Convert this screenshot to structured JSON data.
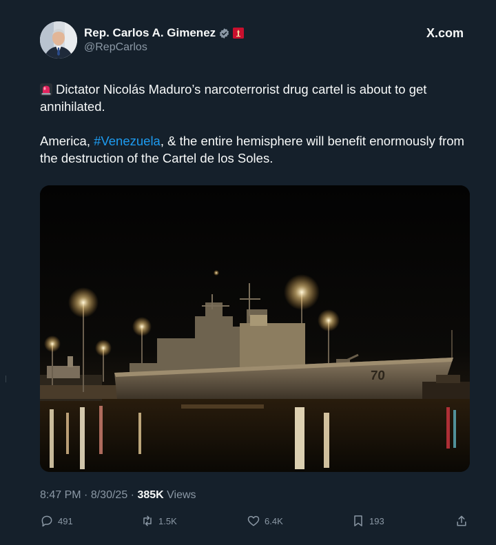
{
  "author": {
    "display_name": "Rep. Carlos A. Gimenez",
    "handle": "@RepCarlos",
    "verified_icon": "verified-badge-icon",
    "affiliation_icon": "government-flag-icon"
  },
  "source": {
    "label": "X.com",
    "icon": "x-logo-icon"
  },
  "tweet": {
    "paragraph1_emoji": "siren-icon",
    "paragraph1": "Dictator Nicolás Maduro’s narcoterrorist drug cartel is about to get annihilated.",
    "paragraph2_before": "America, ",
    "hashtag": "#Venezuela",
    "paragraph2_after": ", & the entire hemisphere will benefit enormously from the destruction of the Cartel de los Soles.",
    "media_description_icon": "warship-at-night-photo",
    "hull_number": "70"
  },
  "meta": {
    "time": "8:47 PM",
    "separator": "·",
    "date": "8/30/25",
    "views_count": "385K",
    "views_label": "Views"
  },
  "actions": {
    "replies": "491",
    "reposts": "1.5K",
    "likes": "6.4K",
    "bookmarks": "193"
  },
  "colors": {
    "background": "#15202b",
    "text_primary": "#f7f9f9",
    "text_secondary": "#8b98a5",
    "link": "#1d9bf0",
    "verified": "#8b98a5",
    "flag": "#c8102e"
  }
}
